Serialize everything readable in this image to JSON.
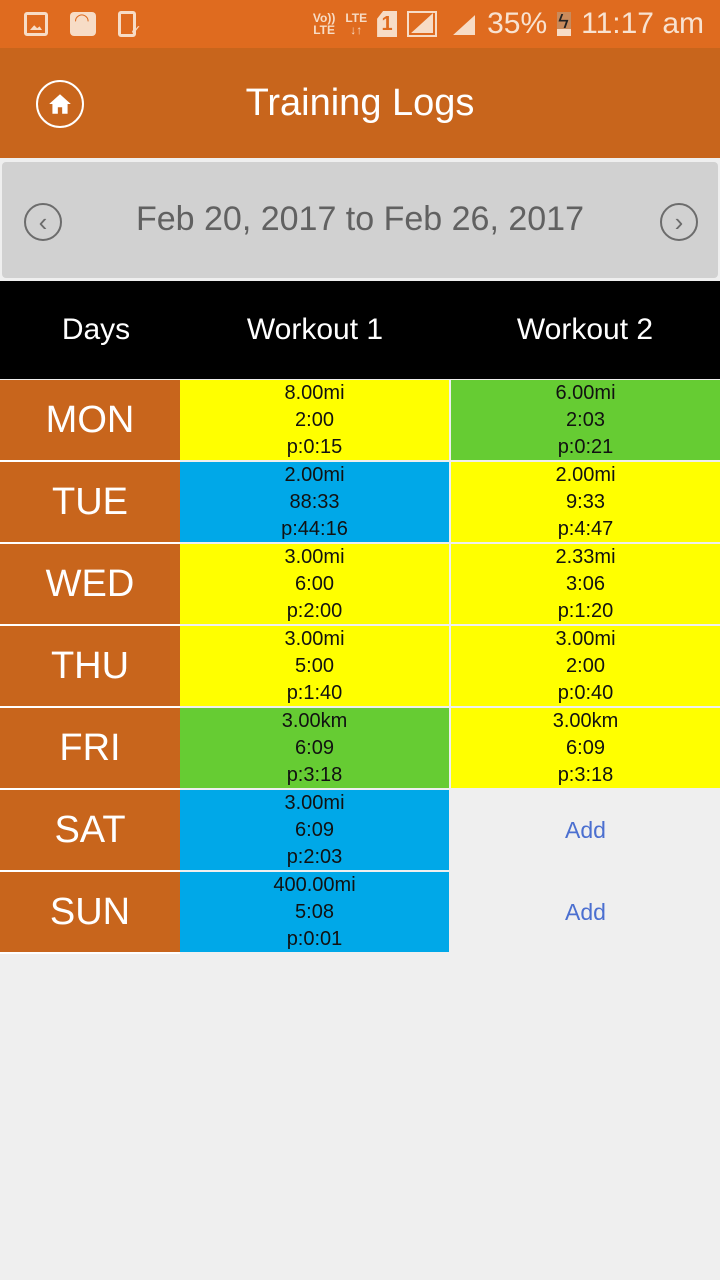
{
  "status_bar": {
    "left_icons": [
      "gallery-icon",
      "wifi-icon",
      "phone-check-icon"
    ],
    "volte_label_top": "Vo))",
    "volte_label_bottom": "LTE",
    "lte_label": "LTE",
    "lte_arrows": "↓↑",
    "sim_number": "1",
    "battery_percent": "35%",
    "time": "11:17 am"
  },
  "app_bar": {
    "title": "Training Logs",
    "home_icon": "home-icon"
  },
  "date_nav": {
    "range": "Feb 20, 2017 to Feb 26, 2017",
    "prev_glyph": "‹",
    "next_glyph": "›"
  },
  "table": {
    "headers": [
      "Days",
      "Workout 1",
      "Workout 2"
    ],
    "colors": {
      "yellow": "#ffff00",
      "green": "#66cc33",
      "blue": "#00a8e8",
      "day": "#c8651c",
      "empty": "#efefef",
      "add_link": "#4b6fd0"
    },
    "rows": [
      {
        "day": "MON",
        "w1": {
          "distance": "8.00mi",
          "time": "2:00",
          "pace": "p:0:15",
          "color": "#ffff00"
        },
        "w2": {
          "distance": "6.00mi",
          "time": "2:03",
          "pace": "p:0:21",
          "color": "#66cc33"
        }
      },
      {
        "day": "TUE",
        "w1": {
          "distance": "2.00mi",
          "time": "88:33",
          "pace": "p:44:16",
          "color": "#00a8e8"
        },
        "w2": {
          "distance": "2.00mi",
          "time": "9:33",
          "pace": "p:4:47",
          "color": "#ffff00"
        }
      },
      {
        "day": "WED",
        "w1": {
          "distance": "3.00mi",
          "time": "6:00",
          "pace": "p:2:00",
          "color": "#ffff00"
        },
        "w2": {
          "distance": "2.33mi",
          "time": "3:06",
          "pace": "p:1:20",
          "color": "#ffff00"
        }
      },
      {
        "day": "THU",
        "w1": {
          "distance": "3.00mi",
          "time": "5:00",
          "pace": "p:1:40",
          "color": "#ffff00"
        },
        "w2": {
          "distance": "3.00mi",
          "time": "2:00",
          "pace": "p:0:40",
          "color": "#ffff00"
        }
      },
      {
        "day": "FRI",
        "w1": {
          "distance": "3.00km",
          "time": "6:09",
          "pace": "p:3:18",
          "color": "#66cc33"
        },
        "w2": {
          "distance": "3.00km",
          "time": "6:09",
          "pace": "p:3:18",
          "color": "#ffff00"
        }
      },
      {
        "day": "SAT",
        "w1": {
          "distance": "3.00mi",
          "time": "6:09",
          "pace": "p:2:03",
          "color": "#00a8e8"
        },
        "w2": {
          "add_label": "Add"
        }
      },
      {
        "day": "SUN",
        "w1": {
          "distance": "400.00mi",
          "time": "5:08",
          "pace": "p:0:01",
          "color": "#00a8e8"
        },
        "w2": {
          "add_label": "Add"
        }
      }
    ]
  }
}
